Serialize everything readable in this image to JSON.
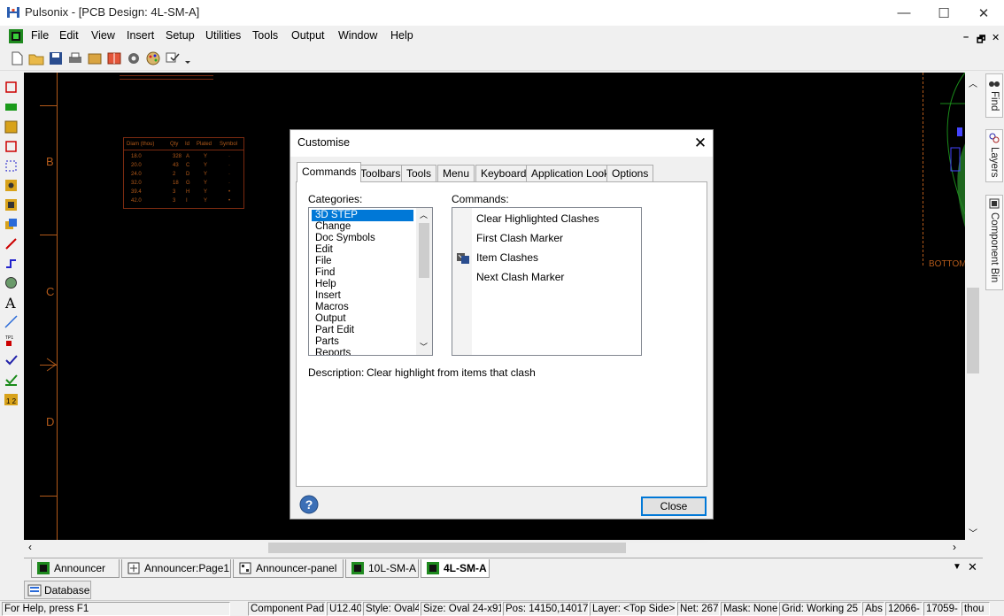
{
  "app": {
    "name": "Pulsonix",
    "title": "Pulsonix - [PCB Design: 4L-SM-A]"
  },
  "window_controls": {
    "minimize": "—",
    "maximize": "☐",
    "close": "✕"
  },
  "menu": [
    "File",
    "Edit",
    "View",
    "Insert",
    "Setup",
    "Utilities",
    "Tools",
    "Output",
    "Window",
    "Help"
  ],
  "mdi_controls": {
    "minimize": "–",
    "restore": "🗗",
    "close": "✕"
  },
  "canvas": {
    "grid_labels": [
      "B",
      "C",
      "D"
    ],
    "board_label": "BOTTOM",
    "drill_table": {
      "headers": [
        "Diam (thou)",
        "Qty",
        "Id",
        "Plated",
        "Symbol"
      ],
      "rows": [
        [
          "18.0",
          "328",
          "A",
          "Y",
          "·"
        ],
        [
          "20.0",
          "43",
          "C",
          "Y",
          "·"
        ],
        [
          "24.0",
          "2",
          "D",
          "Y",
          "·"
        ],
        [
          "32.0",
          "18",
          "G",
          "Y",
          "·"
        ],
        [
          "39.4",
          "3",
          "H",
          "Y",
          "•"
        ],
        [
          "42.0",
          "3",
          "I",
          "Y",
          "•"
        ]
      ]
    }
  },
  "right_dock": [
    "Find",
    "Layers",
    "Component Bin"
  ],
  "doc_tabs": [
    {
      "label": "Announcer",
      "active": false
    },
    {
      "label": "Announcer:Page1",
      "active": false
    },
    {
      "label": "Announcer-panel",
      "active": false
    },
    {
      "label": "10L-SM-A",
      "active": false
    },
    {
      "label": "4L-SM-A",
      "active": true
    }
  ],
  "database_label": "Database",
  "status_bar": {
    "help": "For Help, press F1",
    "item_type": "Component Pad",
    "ref": "U12.40",
    "style": "Style: Oval4",
    "size": "Size: Oval 24-x91-",
    "pos": "Pos: 14150,14017-",
    "layer": "Layer: <Top Side>",
    "net": "Net: 267",
    "mask": "Mask: None",
    "grid": "Grid: Working 25",
    "abs": "Abs",
    "x": "12066-",
    "y": "17059-",
    "units": "thou"
  },
  "dialog": {
    "title": "Customise",
    "close": "✕",
    "tabs": [
      "Commands",
      "Toolbars",
      "Tools",
      "Menu",
      "Keyboard",
      "Application Look",
      "Options"
    ],
    "active_tab": "Commands",
    "categories_label": "Categories:",
    "commands_label": "Commands:",
    "categories": [
      "3D STEP",
      "Change",
      "Doc Symbols",
      "Edit",
      "File",
      "Find",
      "Help",
      "Insert",
      "Macros",
      "Output",
      "Part Edit",
      "Parts",
      "Reports"
    ],
    "selected_category": "3D STEP",
    "commands": [
      "Clear Highlighted Clashes",
      "First Clash Marker",
      "Item Clashes",
      "Next Clash Marker"
    ],
    "description_label": "Description:",
    "description": "Clear highlight from items that clash",
    "close_button": "Close",
    "help_button": "?"
  },
  "colors": {
    "canvas": "#000000",
    "grid_label": "#b35a1a",
    "selection": "#0078d7",
    "dialog_bg": "#f0f0f0"
  }
}
